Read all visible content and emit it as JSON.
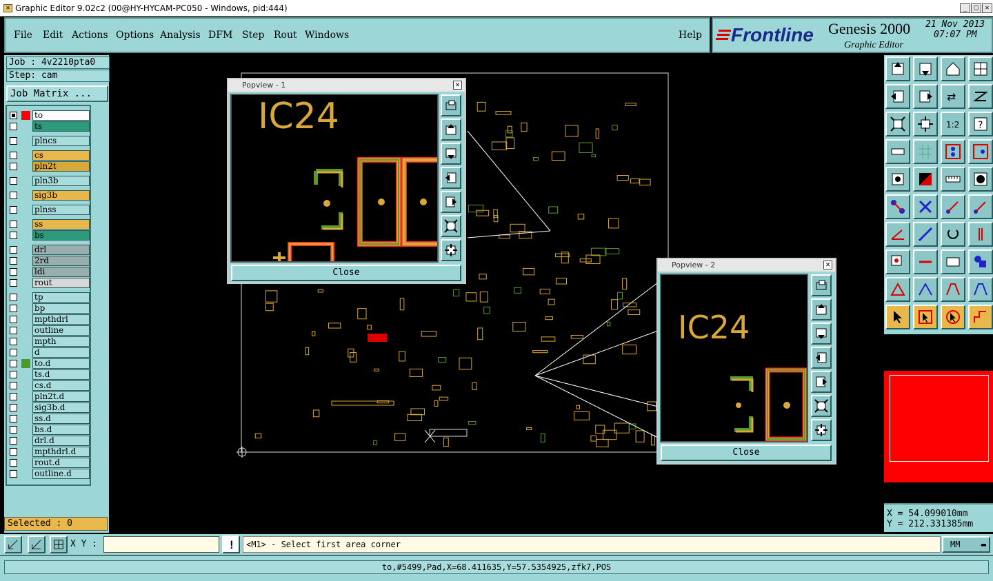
{
  "window": {
    "title": "Graphic Editor 9.02c2 (00@HY-HYCAM-PC050 - Windows, pid:444)"
  },
  "menu": {
    "items": [
      "File",
      "Edit",
      "Actions",
      "Options",
      "Analysis",
      "DFM",
      "Step",
      "Rout",
      "Windows"
    ],
    "help": "Help"
  },
  "brand": {
    "logo": "Frontline",
    "product": "Genesis 2000",
    "subtitle": "Graphic Editor",
    "date": "21 Nov 2013",
    "time": "07:07 PM"
  },
  "job": {
    "job_label": "Job : 4v2210pta0",
    "step_label": "Step: cam",
    "matrix_button": "Job Matrix ..."
  },
  "layers": [
    {
      "name": "to",
      "color": "#ffffff",
      "active": true
    },
    {
      "name": "ts",
      "color": "#2e9a7a"
    },
    {
      "name": "plncs",
      "color": "#a9dcdc"
    },
    {
      "name": "cs",
      "color": "#e8b84a"
    },
    {
      "name": "pln2t",
      "color": "#d8a838"
    },
    {
      "name": "pln3b",
      "color": "#a9dcdc"
    },
    {
      "name": "sig3b",
      "color": "#e8b84a"
    },
    {
      "name": "plnss",
      "color": "#a9dcdc"
    },
    {
      "name": "ss",
      "color": "#e8b84a"
    },
    {
      "name": "bs",
      "color": "#2e9a7a"
    },
    {
      "name": "drl",
      "color": "#9aaeae"
    },
    {
      "name": "2rd",
      "color": "#9aaeae"
    },
    {
      "name": "ldi",
      "color": "#9aaeae"
    },
    {
      "name": "rout",
      "color": "#d8d8d8"
    },
    {
      "name": "tp",
      "color": "#a9dcdc"
    },
    {
      "name": "bp",
      "color": "#a9dcdc"
    },
    {
      "name": "mpthdrl",
      "color": "#a9dcdc"
    },
    {
      "name": "outline",
      "color": "#a9dcdc"
    },
    {
      "name": "mpth",
      "color": "#a9dcdc"
    },
    {
      "name": "d",
      "color": "#a9dcdc"
    },
    {
      "name": "to.d",
      "color": "#a9dcdc"
    },
    {
      "name": "ts.d",
      "color": "#a9dcdc"
    },
    {
      "name": "cs.d",
      "color": "#a9dcdc"
    },
    {
      "name": "pln2t.d",
      "color": "#a9dcdc"
    },
    {
      "name": "sig3b.d",
      "color": "#a9dcdc"
    },
    {
      "name": "ss.d",
      "color": "#a9dcdc"
    },
    {
      "name": "bs.d",
      "color": "#a9dcdc"
    },
    {
      "name": "drl.d",
      "color": "#a9dcdc"
    },
    {
      "name": "mpthdrl.d",
      "color": "#a9dcdc"
    },
    {
      "name": "rout.d",
      "color": "#a9dcdc"
    },
    {
      "name": "outline.d",
      "color": "#a9dcdc"
    }
  ],
  "selected": "Selected : 0",
  "popview1": {
    "title": "Popview - 1",
    "label": "IC24",
    "close": "Close"
  },
  "popview2": {
    "title": "Popview - 2",
    "label": "IC24",
    "close": "Close"
  },
  "coords": {
    "x": "X =  54.099010mm",
    "y": "Y = 212.331385mm"
  },
  "input": {
    "xy_label": "X Y :",
    "prompt": "<M1> - Select first area corner",
    "units": "MM"
  },
  "status": "to,#5499,Pad,X=68.411635,Y=57.5354925,zfk7,POS",
  "colors": {
    "panel": "#9dd6d6",
    "accent_red": "#ff0000",
    "layer_orange": "#e8b84a",
    "layer_green": "#2e9a7a"
  }
}
